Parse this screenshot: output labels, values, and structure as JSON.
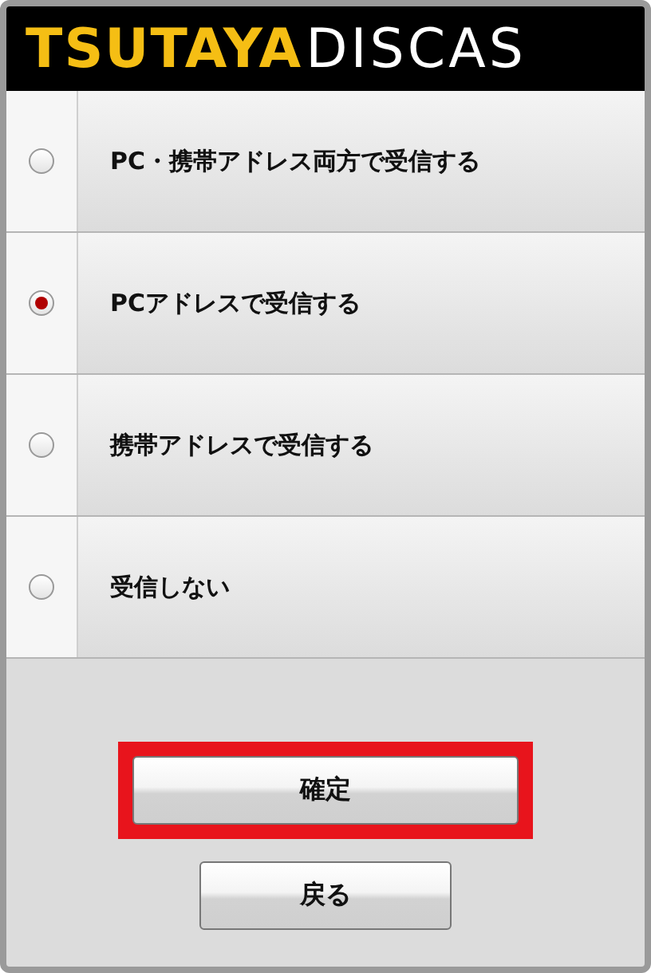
{
  "header": {
    "logo_part_1": "TSUTAYA",
    "logo_part_2": "DISCAS"
  },
  "options": [
    {
      "label": "PC・携帯アドレス両方で受信する",
      "selected": false
    },
    {
      "label": "PCアドレスで受信する",
      "selected": true
    },
    {
      "label": "携帯アドレスで受信する",
      "selected": false
    },
    {
      "label": "受信しない",
      "selected": false
    }
  ],
  "buttons": [
    {
      "label": "確定",
      "highlighted": true
    },
    {
      "label": "戻る",
      "highlighted": false
    }
  ]
}
